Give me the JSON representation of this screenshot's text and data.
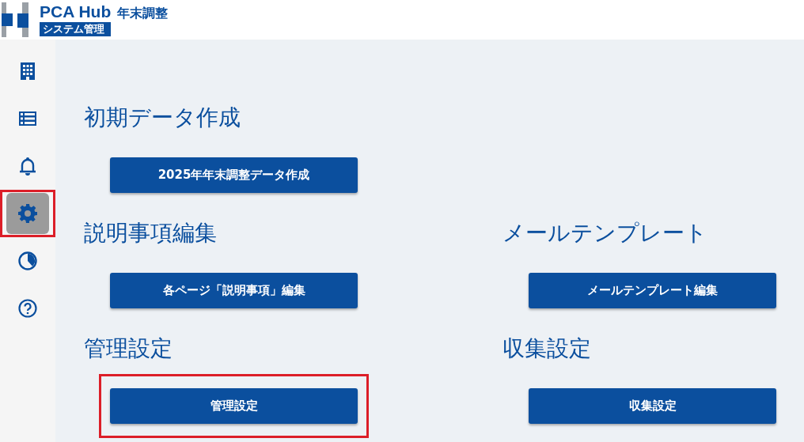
{
  "header": {
    "title": "PCA Hub",
    "product": "年末調整",
    "badge": "システム管理"
  },
  "sidebar": {
    "items": [
      {
        "kind": "building",
        "selected": false,
        "highlighted": false
      },
      {
        "kind": "list",
        "selected": false,
        "highlighted": false
      },
      {
        "kind": "bell",
        "selected": false,
        "highlighted": false
      },
      {
        "kind": "gear",
        "selected": true,
        "highlighted": true
      },
      {
        "kind": "pie",
        "selected": false,
        "highlighted": false
      },
      {
        "kind": "help",
        "selected": false,
        "highlighted": false
      }
    ]
  },
  "rows": [
    [
      {
        "title": "初期データ作成",
        "button": "2025年年末調整データ作成",
        "highlighted": false
      }
    ],
    [
      {
        "title": "説明事項編集",
        "button": "各ページ「説明事項」編集",
        "highlighted": false
      },
      {
        "title": "メールテンプレート",
        "button": "メールテンプレート編集",
        "highlighted": false
      }
    ],
    [
      {
        "title": "管理設定",
        "button": "管理設定",
        "highlighted": true
      },
      {
        "title": "収集設定",
        "button": "収集設定",
        "highlighted": false
      }
    ]
  ]
}
